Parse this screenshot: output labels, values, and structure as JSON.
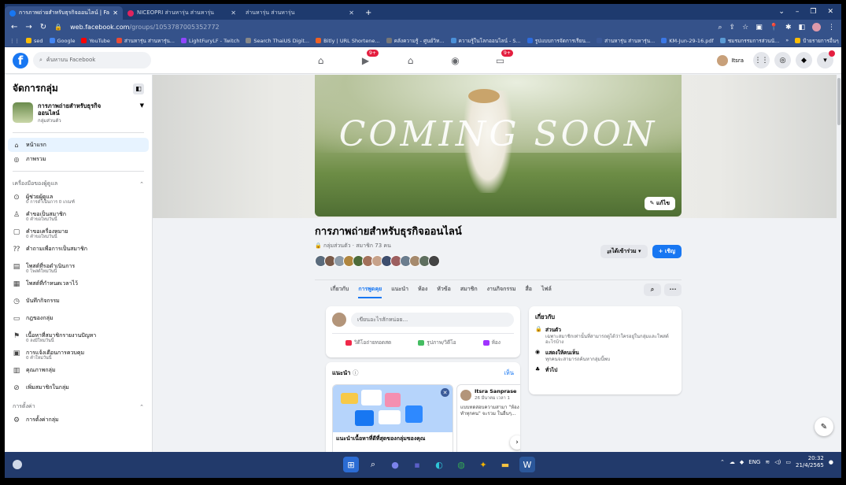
{
  "browser": {
    "tabs": [
      {
        "label": "การภาพถ่ายสำหรับธุรกิจออนไลน์ | Fa",
        "active": true
      },
      {
        "label": "NICEOPRI ส่านหารุ่น ส่านหารุ่น",
        "active": false
      },
      {
        "label": "ส่านหารุ่น ส่านหารุ่น",
        "active": false
      }
    ],
    "new_tab": "+",
    "url_host": "web.facebook.com",
    "url_path": "/groups/1053787005352772",
    "bookmarks": [
      "sed",
      "Google",
      "YouTube",
      "ส่านหารุ่น ส่านหารุ่น...",
      "LightFuryLF - Twitch",
      "Search ThaiUS Digit...",
      "Bitly | URL Shortene...",
      "คลังความรู้ - ศูนย์วิท...",
      "ความรู้ในโลกออนไลน์ - S...",
      "รูปแบบการจัดการเรียน...",
      "ส่านหารุ่น ส่านหารุ่น...",
      "KM-Jun-29-16.pdf",
      "ชมรมกรรมการส่วนนั..."
    ],
    "bookmarks_right": "ป้ายรายการอื่นๆ"
  },
  "fb": {
    "search_placeholder": "ค้นหาบน Facebook",
    "user_name": "Itsra",
    "badges": {
      "watch": "9+",
      "gaming": "9+"
    }
  },
  "sidebar": {
    "title": "จัดการกลุ่ม",
    "group_name": "การภาพถ่ายสำหรับธุรกิจออนไลน์",
    "group_privacy": "กลุ่มส่วนตัว",
    "nav": [
      {
        "label": "หน้าแรก",
        "icon": "home-icon"
      },
      {
        "label": "ภาพรวม",
        "icon": "explore-icon"
      }
    ],
    "admin_tools_header": "เครื่องมือของผู้ดูแล",
    "admin_tools": [
      {
        "label": "ผู้ช่วยผู้ดูแล",
        "sub": "0 การดำเนินการ 0 เกณฑ์"
      },
      {
        "label": "คำขอเป็นสมาชิก",
        "sub": "0 คำขอใหม่วันนี้"
      },
      {
        "label": "คำขอเครื่องหมาย",
        "sub": "0 คำขอใหม่วันนี้"
      },
      {
        "label": "คำถามเพื่อการเป็นสมาชิก",
        "sub": ""
      },
      {
        "label": "โพสต์ที่รอดำเนินการ",
        "sub": "0 โพสต์ใหม่วันนี้"
      },
      {
        "label": "โพสต์ที่กำหนดเวลาไว้",
        "sub": ""
      },
      {
        "label": "บันทึกกิจกรรม",
        "sub": ""
      },
      {
        "label": "กฎของกลุ่ม",
        "sub": ""
      },
      {
        "label": "เนื้อหาที่สมาชิกรายงานปัญหา",
        "sub": "0 ลงมีใหม่วันนี้"
      },
      {
        "label": "การแจ้งเตือนการควบคุม",
        "sub": "0 คำใหม่วันนี้"
      },
      {
        "label": "คุณภาพกลุ่ม",
        "sub": ""
      },
      {
        "label": "เพิ่มสมาชิกในกลุ่ม",
        "sub": ""
      }
    ],
    "settings_header": "การตั้งค่า",
    "settings_first": "การตั้งค่ากลุ่ม"
  },
  "cover": {
    "text": "COMING SOON",
    "edit_label": "แก้ไข"
  },
  "group": {
    "name": "การภาพถ่ายสำหรับธุรกิจออนไลน์",
    "meta": "กลุ่มส่วนตัว · สมาชิก 73 คน",
    "member_avatar_colors": [
      "#5a6b7c",
      "#7a5b4a",
      "#8d9aa6",
      "#b0863f",
      "#4d6b3a",
      "#a3715b",
      "#c7a28a",
      "#3e4e6e",
      "#9d5f5f",
      "#6b7d8e",
      "#a68a6d",
      "#5f6f5f",
      "#444"
    ],
    "joined_label": "ได้เข้าร่วม ▾",
    "invite_label": "+ เชิญ",
    "tabs": [
      "เกี่ยวกับ",
      "การพูดคุย",
      "แนะนำ",
      "ห้อง",
      "หัวข้อ",
      "สมาชิก",
      "งานกิจกรรม",
      "สื่อ",
      "ไฟล์"
    ],
    "active_tab": "การพูดคุย"
  },
  "composer": {
    "placeholder": "เขียนอะไรสักหน่อย...",
    "actions": [
      "วิดีโอถ่ายทอดสด",
      "รูปภาพ/วิดีโอ",
      "ห้อง"
    ]
  },
  "recommend": {
    "title": "แนะนำ",
    "see_all": "เห็น",
    "card1_caption": "แนะนำเนื้อหาที่ดีที่สุดของกลุ่มของคุณ",
    "card2_author": "Itsra Sanprase",
    "card2_date": "26 มีนาคม เวลา 1",
    "card2_text": "แบบทดสอบความสามา \"ห้องทำทุกคน\" จะรวม ในอื่นๆ..."
  },
  "about": {
    "title": "เกี่ยวกับ",
    "rows": [
      {
        "title": "ส่วนตัว",
        "desc": "เฉพาะสมาชิกเท่านั้นที่สามารถดูได้ว่าใครอยู่ในกลุ่มและโพสต์อะไรบ้าง"
      },
      {
        "title": "แสดงให้คนเห็น",
        "desc": "ทุกคนจะสามารถค้นหากลุ่มนี้พบ"
      },
      {
        "title": "ทั่วไป",
        "desc": ""
      }
    ]
  },
  "taskbar": {
    "lang": "ENG",
    "time": "20:32",
    "date": "21/4/2565"
  }
}
